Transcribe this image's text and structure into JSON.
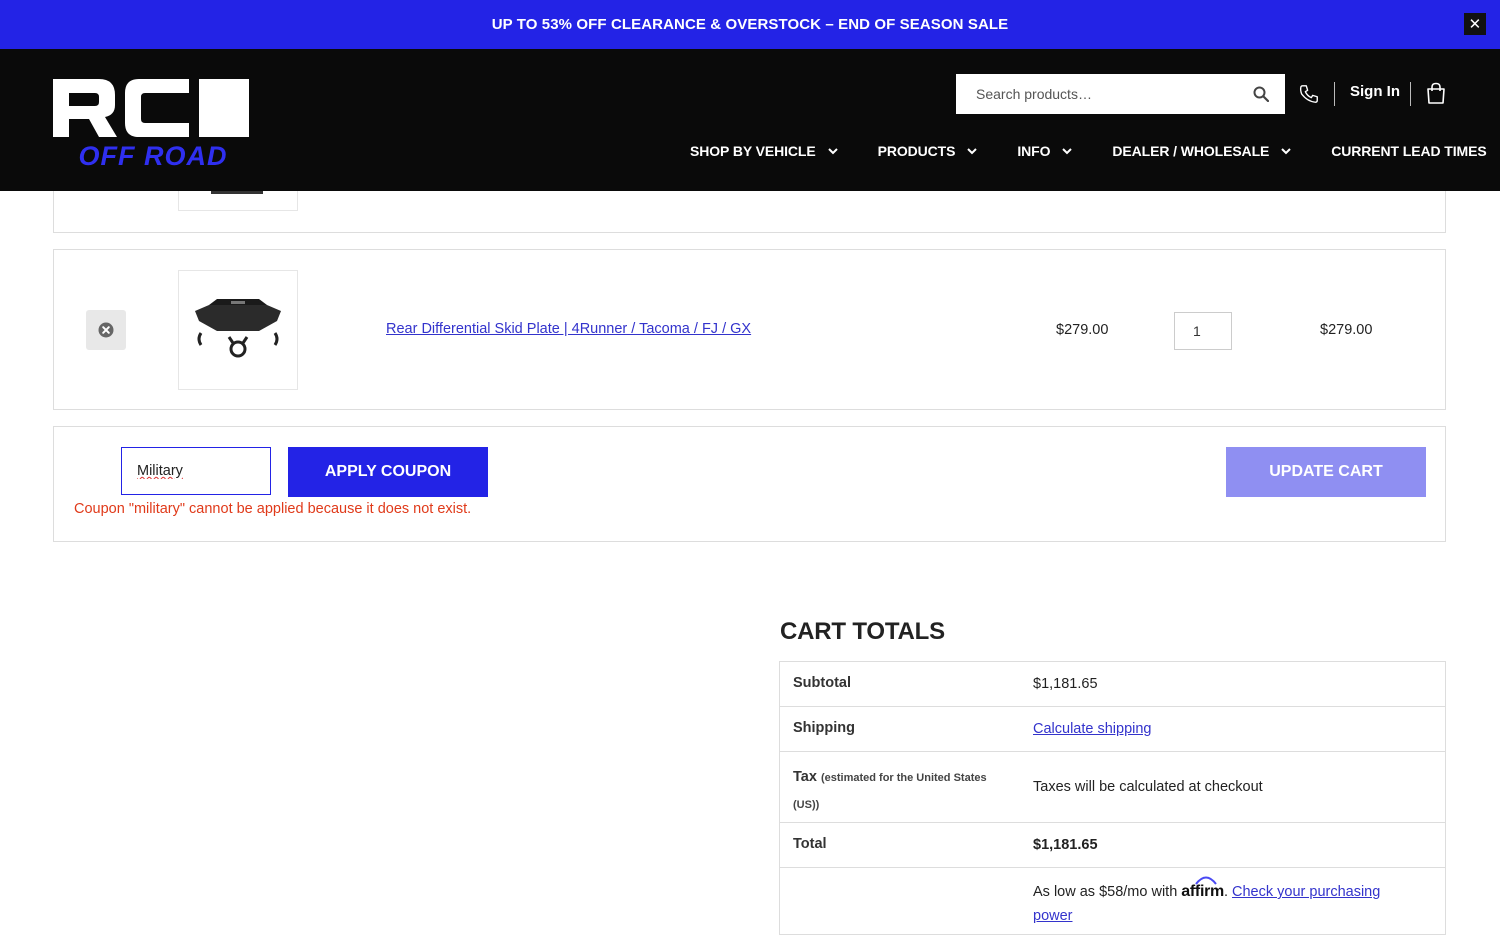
{
  "promo": {
    "text": "UP TO 53% OFF CLEARANCE & OVERSTOCK – END OF SEASON SALE",
    "close_label": "✕"
  },
  "header": {
    "logo": {
      "line1": "RCI",
      "line2": "OFF ROAD"
    },
    "search": {
      "placeholder": "Search products…",
      "icon": "search-icon"
    },
    "phone_icon": "phone-icon",
    "sign_in": "Sign In",
    "cart_icon": "shopping-bag-icon",
    "nav": [
      {
        "label": "SHOP BY VEHICLE",
        "has_dropdown": true
      },
      {
        "label": "PRODUCTS",
        "has_dropdown": true
      },
      {
        "label": "INFO",
        "has_dropdown": true
      },
      {
        "label": "DEALER / WHOLESALE",
        "has_dropdown": true
      },
      {
        "label": "CURRENT LEAD TIMES",
        "has_dropdown": false
      }
    ]
  },
  "cart": {
    "items": [
      {
        "name": "Rear Differential Skid Plate | 4Runner / Tacoma / FJ / GX",
        "price": "$279.00",
        "quantity": "1",
        "subtotal": "$279.00"
      }
    ],
    "coupon": {
      "value": "Military",
      "apply_label": "APPLY COUPON",
      "error": "Coupon \"military\" cannot be applied because it does not exist."
    },
    "update_label": "UPDATE CART"
  },
  "totals": {
    "title": "CART TOTALS",
    "subtotal_label": "Subtotal",
    "subtotal_value": "$1,181.65",
    "shipping_label": "Shipping",
    "shipping_link": "Calculate shipping",
    "tax_label": "Tax",
    "tax_note": "(estimated for the United States (US))",
    "tax_value": "Taxes will be calculated at checkout",
    "total_label": "Total",
    "total_value": "$1,181.65",
    "affirm_prefix": "As low as $58/mo with",
    "affirm_brand": "affirm",
    "affirm_link": "Check your purchasing power"
  },
  "colors": {
    "brand_blue": "#2323e6",
    "disabled_blue": "#8f8ff2",
    "error_red": "#e03a1a",
    "link_blue": "#3333cc",
    "header_bg": "#0a0a0a"
  }
}
